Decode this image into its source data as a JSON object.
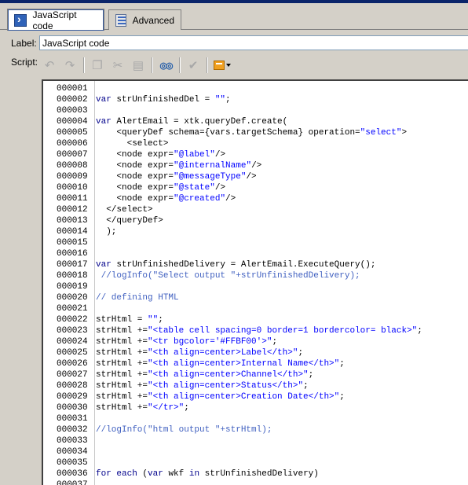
{
  "tabs": [
    {
      "label": "JavaScript code",
      "icon": "javascript-icon",
      "active": true
    },
    {
      "label": "Advanced",
      "icon": "advanced-icon",
      "active": false
    }
  ],
  "form": {
    "label_caption": "Label:",
    "label_value": "JavaScript code",
    "script_caption": "Script:"
  },
  "toolbar": {
    "buttons": [
      {
        "name": "undo-icon",
        "glyph": "↶",
        "enabled": false
      },
      {
        "name": "redo-icon",
        "glyph": "↷",
        "enabled": false
      },
      {
        "name": "copy-icon",
        "glyph": "❐",
        "enabled": false
      },
      {
        "name": "cut-icon",
        "glyph": "✂",
        "enabled": false
      },
      {
        "name": "paste-icon",
        "glyph": "▤",
        "enabled": false
      },
      {
        "name": "find-binoculars-icon",
        "glyph": "◎◎",
        "enabled": true
      },
      {
        "name": "validate-icon",
        "glyph": "✔",
        "enabled": false
      },
      {
        "name": "insert-field-icon",
        "glyph": "",
        "enabled": true
      }
    ]
  },
  "code_lines": [
    {
      "n": "000001",
      "t": []
    },
    {
      "n": "000002",
      "t": [
        [
          "kw",
          "var "
        ],
        [
          "",
          "strUnfinishedDel = "
        ],
        [
          "str",
          "\"\""
        ],
        [
          "",
          ";"
        ]
      ]
    },
    {
      "n": "000003",
      "t": []
    },
    {
      "n": "000004",
      "t": [
        [
          "kw",
          "var "
        ],
        [
          "",
          "AlertEmail = xtk.queryDef.create("
        ]
      ]
    },
    {
      "n": "000005",
      "t": [
        [
          "",
          "    <queryDef schema={vars.targetSchema} operation="
        ],
        [
          "str",
          "\"select\""
        ],
        [
          "",
          ">"
        ]
      ]
    },
    {
      "n": "000006",
      "t": [
        [
          "",
          "      <select>"
        ]
      ]
    },
    {
      "n": "000007",
      "t": [
        [
          "",
          "    <node expr="
        ],
        [
          "str",
          "\"@label\""
        ],
        [
          "",
          "/>"
        ]
      ]
    },
    {
      "n": "000008",
      "t": [
        [
          "",
          "    <node expr="
        ],
        [
          "str",
          "\"@internalName\""
        ],
        [
          "",
          "/>"
        ]
      ]
    },
    {
      "n": "000009",
      "t": [
        [
          "",
          "    <node expr="
        ],
        [
          "str",
          "\"@messageType\""
        ],
        [
          "",
          "/>"
        ]
      ]
    },
    {
      "n": "000010",
      "t": [
        [
          "",
          "    <node expr="
        ],
        [
          "str",
          "\"@state\""
        ],
        [
          "",
          "/>"
        ]
      ]
    },
    {
      "n": "000011",
      "t": [
        [
          "",
          "    <node expr="
        ],
        [
          "str",
          "\"@created\""
        ],
        [
          "",
          "/>"
        ]
      ]
    },
    {
      "n": "000012",
      "t": [
        [
          "",
          "  </select>"
        ]
      ]
    },
    {
      "n": "000013",
      "t": [
        [
          "",
          "  </queryDef>"
        ]
      ]
    },
    {
      "n": "000014",
      "t": [
        [
          "",
          "  );"
        ]
      ]
    },
    {
      "n": "000015",
      "t": []
    },
    {
      "n": "000016",
      "t": []
    },
    {
      "n": "000017",
      "t": [
        [
          "kw",
          "var "
        ],
        [
          "",
          "strUnfinishedDelivery = AlertEmail.ExecuteQuery();"
        ]
      ]
    },
    {
      "n": "000018",
      "t": [
        [
          "cm",
          " //logInfo(\"Select output \"+strUnfinishedDelivery);"
        ]
      ]
    },
    {
      "n": "000019",
      "t": []
    },
    {
      "n": "000020",
      "t": [
        [
          "cm",
          "// defining HTML"
        ]
      ]
    },
    {
      "n": "000021",
      "t": []
    },
    {
      "n": "000022",
      "t": [
        [
          "",
          "strHtml = "
        ],
        [
          "str",
          "\"\""
        ],
        [
          "",
          ";"
        ]
      ]
    },
    {
      "n": "000023",
      "t": [
        [
          "",
          "strHtml +="
        ],
        [
          "str",
          "\"<table cell spacing=0 border=1 bordercolor= black>\""
        ],
        [
          "",
          ";"
        ]
      ]
    },
    {
      "n": "000024",
      "t": [
        [
          "",
          "strHtml +="
        ],
        [
          "str",
          "\"<tr bgcolor='#FFBF00'>\""
        ],
        [
          "",
          ";"
        ]
      ]
    },
    {
      "n": "000025",
      "t": [
        [
          "",
          "strHtml +="
        ],
        [
          "str",
          "\"<th align=center>Label</th>\""
        ],
        [
          "",
          ";"
        ]
      ]
    },
    {
      "n": "000026",
      "t": [
        [
          "",
          "strHtml +="
        ],
        [
          "str",
          "\"<th align=center>Internal Name</th>\""
        ],
        [
          "",
          ";"
        ]
      ]
    },
    {
      "n": "000027",
      "t": [
        [
          "",
          "strHtml +="
        ],
        [
          "str",
          "\"<th align=center>Channel</th>\""
        ],
        [
          "",
          ";"
        ]
      ]
    },
    {
      "n": "000028",
      "t": [
        [
          "",
          "strHtml +="
        ],
        [
          "str",
          "\"<th align=center>Status</th>\""
        ],
        [
          "",
          ";"
        ]
      ]
    },
    {
      "n": "000029",
      "t": [
        [
          "",
          "strHtml +="
        ],
        [
          "str",
          "\"<th align=center>Creation Date</th>\""
        ],
        [
          "",
          ";"
        ]
      ]
    },
    {
      "n": "000030",
      "t": [
        [
          "",
          "strHtml +="
        ],
        [
          "str",
          "\"</tr>\""
        ],
        [
          "",
          ";"
        ]
      ]
    },
    {
      "n": "000031",
      "t": []
    },
    {
      "n": "000032",
      "t": [
        [
          "cm",
          "//logInfo(\"html output \"+strHtml);"
        ]
      ]
    },
    {
      "n": "000033",
      "t": []
    },
    {
      "n": "000034",
      "t": []
    },
    {
      "n": "000035",
      "t": []
    },
    {
      "n": "000036",
      "t": [
        [
          "kw",
          "for each "
        ],
        [
          "",
          "("
        ],
        [
          "kw",
          "var "
        ],
        [
          "",
          "wkf "
        ],
        [
          "kw",
          "in "
        ],
        [
          "",
          "strUnfinishedDelivery)"
        ]
      ]
    },
    {
      "n": "000037",
      "t": []
    }
  ],
  "colors": {
    "keyword": "#00008b",
    "string": "#0000ff",
    "comment": "#4060c0",
    "chrome": "#d4d0c8"
  }
}
